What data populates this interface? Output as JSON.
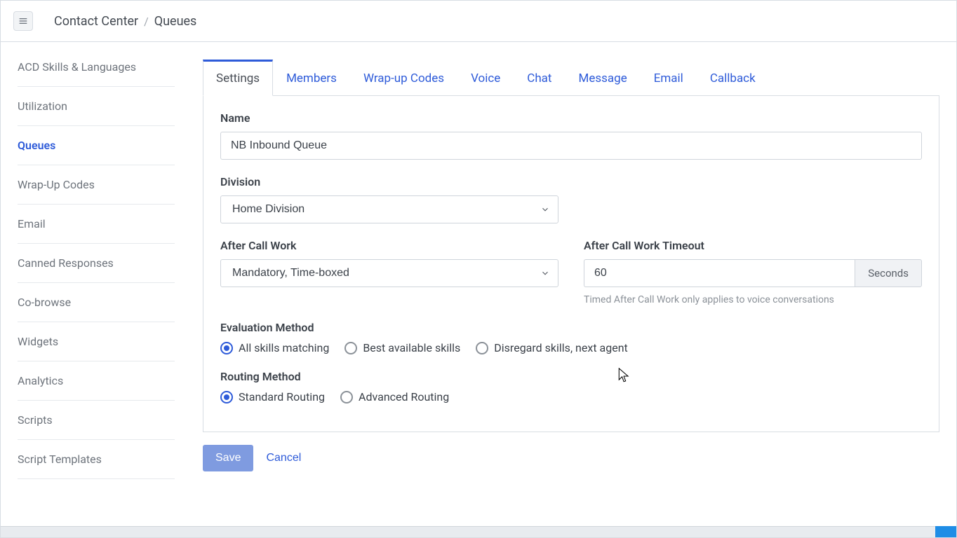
{
  "header": {
    "breadcrumb_parent": "Contact Center",
    "breadcrumb_current": "Queues"
  },
  "sidebar": {
    "items": [
      {
        "label": "ACD Skills & Languages",
        "active": false
      },
      {
        "label": "Utilization",
        "active": false
      },
      {
        "label": "Queues",
        "active": true
      },
      {
        "label": "Wrap-Up Codes",
        "active": false
      },
      {
        "label": "Email",
        "active": false
      },
      {
        "label": "Canned Responses",
        "active": false
      },
      {
        "label": "Co-browse",
        "active": false
      },
      {
        "label": "Widgets",
        "active": false
      },
      {
        "label": "Analytics",
        "active": false
      },
      {
        "label": "Scripts",
        "active": false
      },
      {
        "label": "Script Templates",
        "active": false
      }
    ]
  },
  "tabs": [
    {
      "label": "Settings",
      "active": true
    },
    {
      "label": "Members",
      "active": false
    },
    {
      "label": "Wrap-up Codes",
      "active": false
    },
    {
      "label": "Voice",
      "active": false
    },
    {
      "label": "Chat",
      "active": false
    },
    {
      "label": "Message",
      "active": false
    },
    {
      "label": "Email",
      "active": false
    },
    {
      "label": "Callback",
      "active": false
    }
  ],
  "form": {
    "name_label": "Name",
    "name_value": "NB Inbound Queue",
    "division_label": "Division",
    "division_value": "Home Division",
    "acw_label": "After Call Work",
    "acw_value": "Mandatory, Time-boxed",
    "acw_timeout_label": "After Call Work Timeout",
    "acw_timeout_value": "60",
    "acw_timeout_unit": "Seconds",
    "acw_help": "Timed After Call Work only applies to voice conversations",
    "eval_label": "Evaluation Method",
    "eval_options": [
      {
        "label": "All skills matching",
        "selected": true
      },
      {
        "label": "Best available skills",
        "selected": false
      },
      {
        "label": "Disregard skills, next agent",
        "selected": false
      }
    ],
    "routing_label": "Routing Method",
    "routing_options": [
      {
        "label": "Standard Routing",
        "selected": true
      },
      {
        "label": "Advanced Routing",
        "selected": false
      }
    ]
  },
  "actions": {
    "save": "Save",
    "cancel": "Cancel"
  }
}
